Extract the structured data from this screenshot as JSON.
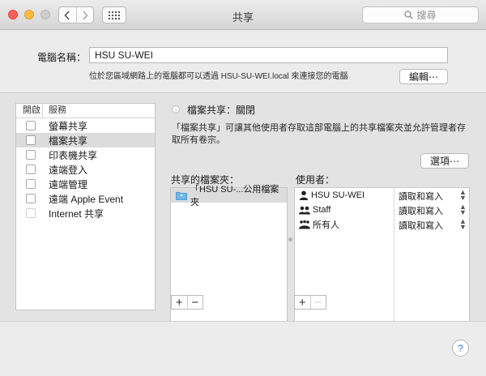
{
  "window": {
    "title": "共享",
    "search_placeholder": "搜尋"
  },
  "computer_name": {
    "label": "電腦名稱：",
    "value": "HSU SU-WEI",
    "description": "位於您區域網路上的電腦都可以透過 HSU-SU-WEI.local 來連接您的電腦",
    "edit_label": "編輯⋯"
  },
  "services": {
    "header_on": "開啟",
    "header_service": "服務",
    "items": [
      {
        "label": "螢幕共享",
        "selected": false
      },
      {
        "label": "檔案共享",
        "selected": true
      },
      {
        "label": "印表機共享",
        "selected": false
      },
      {
        "label": "遠端登入",
        "selected": false
      },
      {
        "label": "遠端管理",
        "selected": false
      },
      {
        "label": "遠端 Apple Event",
        "selected": false
      },
      {
        "label": "Internet 共享",
        "selected": false
      }
    ]
  },
  "file_sharing": {
    "status": "檔案共享：關閉",
    "description": "「檔案共享」可讓其他使用者存取這部電腦上的共享檔案夾並允許管理者存取所有卷宗。",
    "options_label": "選項⋯",
    "shared_folders_label": "共享的檔案夾：",
    "users_label": "使用者：",
    "folders": [
      "「HSU SU-...公用檔案夾"
    ],
    "users": [
      {
        "name": "HSU SU-WEI",
        "permission": "讀取和寫入",
        "icon": "user-icon"
      },
      {
        "name": "Staff",
        "permission": "讀取和寫入",
        "icon": "group-icon"
      },
      {
        "name": "所有人",
        "permission": "讀取和寫入",
        "icon": "everyone-icon"
      }
    ]
  },
  "controls": {
    "plus": "+",
    "minus": "−",
    "help": "?"
  }
}
